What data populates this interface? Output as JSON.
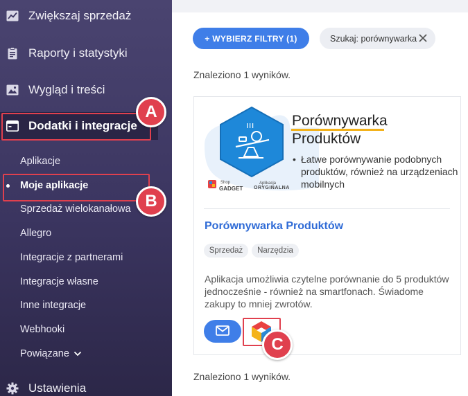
{
  "sidebar": {
    "main_items": [
      {
        "label": "Zwiększaj sprzedaż",
        "icon": "chart-line-icon"
      },
      {
        "label": "Raporty i statystyki",
        "icon": "clipboard-icon"
      },
      {
        "label": "Wygląd i treści",
        "icon": "image-icon"
      },
      {
        "label": "Dodatki i integracje",
        "icon": "window-icon"
      },
      {
        "label": "Ustawienia",
        "icon": "gear-icon"
      }
    ],
    "sub_items": [
      {
        "label": "Aplikacje"
      },
      {
        "label": "Moje aplikacje"
      },
      {
        "label": "Sprzedaż wielokanałowa"
      },
      {
        "label": "Allegro"
      },
      {
        "label": "Integracje z partnerami"
      },
      {
        "label": "Integracje własne"
      },
      {
        "label": "Inne integracje"
      },
      {
        "label": "Webhooki"
      },
      {
        "label": "Powiązane"
      }
    ]
  },
  "filters": {
    "button_label": "+ WYBIERZ FILTRY (1)",
    "search_chip": "Szukaj: porównywarka"
  },
  "results": {
    "found_top": "Znaleziono 1 wyników.",
    "found_bottom": "Znaleziono 1 wyników."
  },
  "app_card": {
    "banner_title_line1": "Porównywarka",
    "banner_title_line2": "Produktów",
    "banner_bullet": "Łatwe porównywanie podobnych produktów, również na urządzeniach mobilnych",
    "banner_brand_small": "Shop",
    "banner_brand": "GADGET",
    "banner_badge_small": "Aplikacja",
    "banner_badge": "ORYGINALNA",
    "title": "Porównywarka Produktów",
    "tags": [
      "Sprzedaż",
      "Narzędzia"
    ],
    "description": "Aplikacja umożliwia czytelne porównanie do 5 produktów jednocześnie - również na smartfonach. Świadome zakupy to mniej zwrotów."
  },
  "annotations": {
    "a": "A",
    "b": "B",
    "c": "C"
  },
  "colors": {
    "accent": "#3f7ee8",
    "highlight": "#e0404e",
    "sidebar": "#3b3560"
  }
}
